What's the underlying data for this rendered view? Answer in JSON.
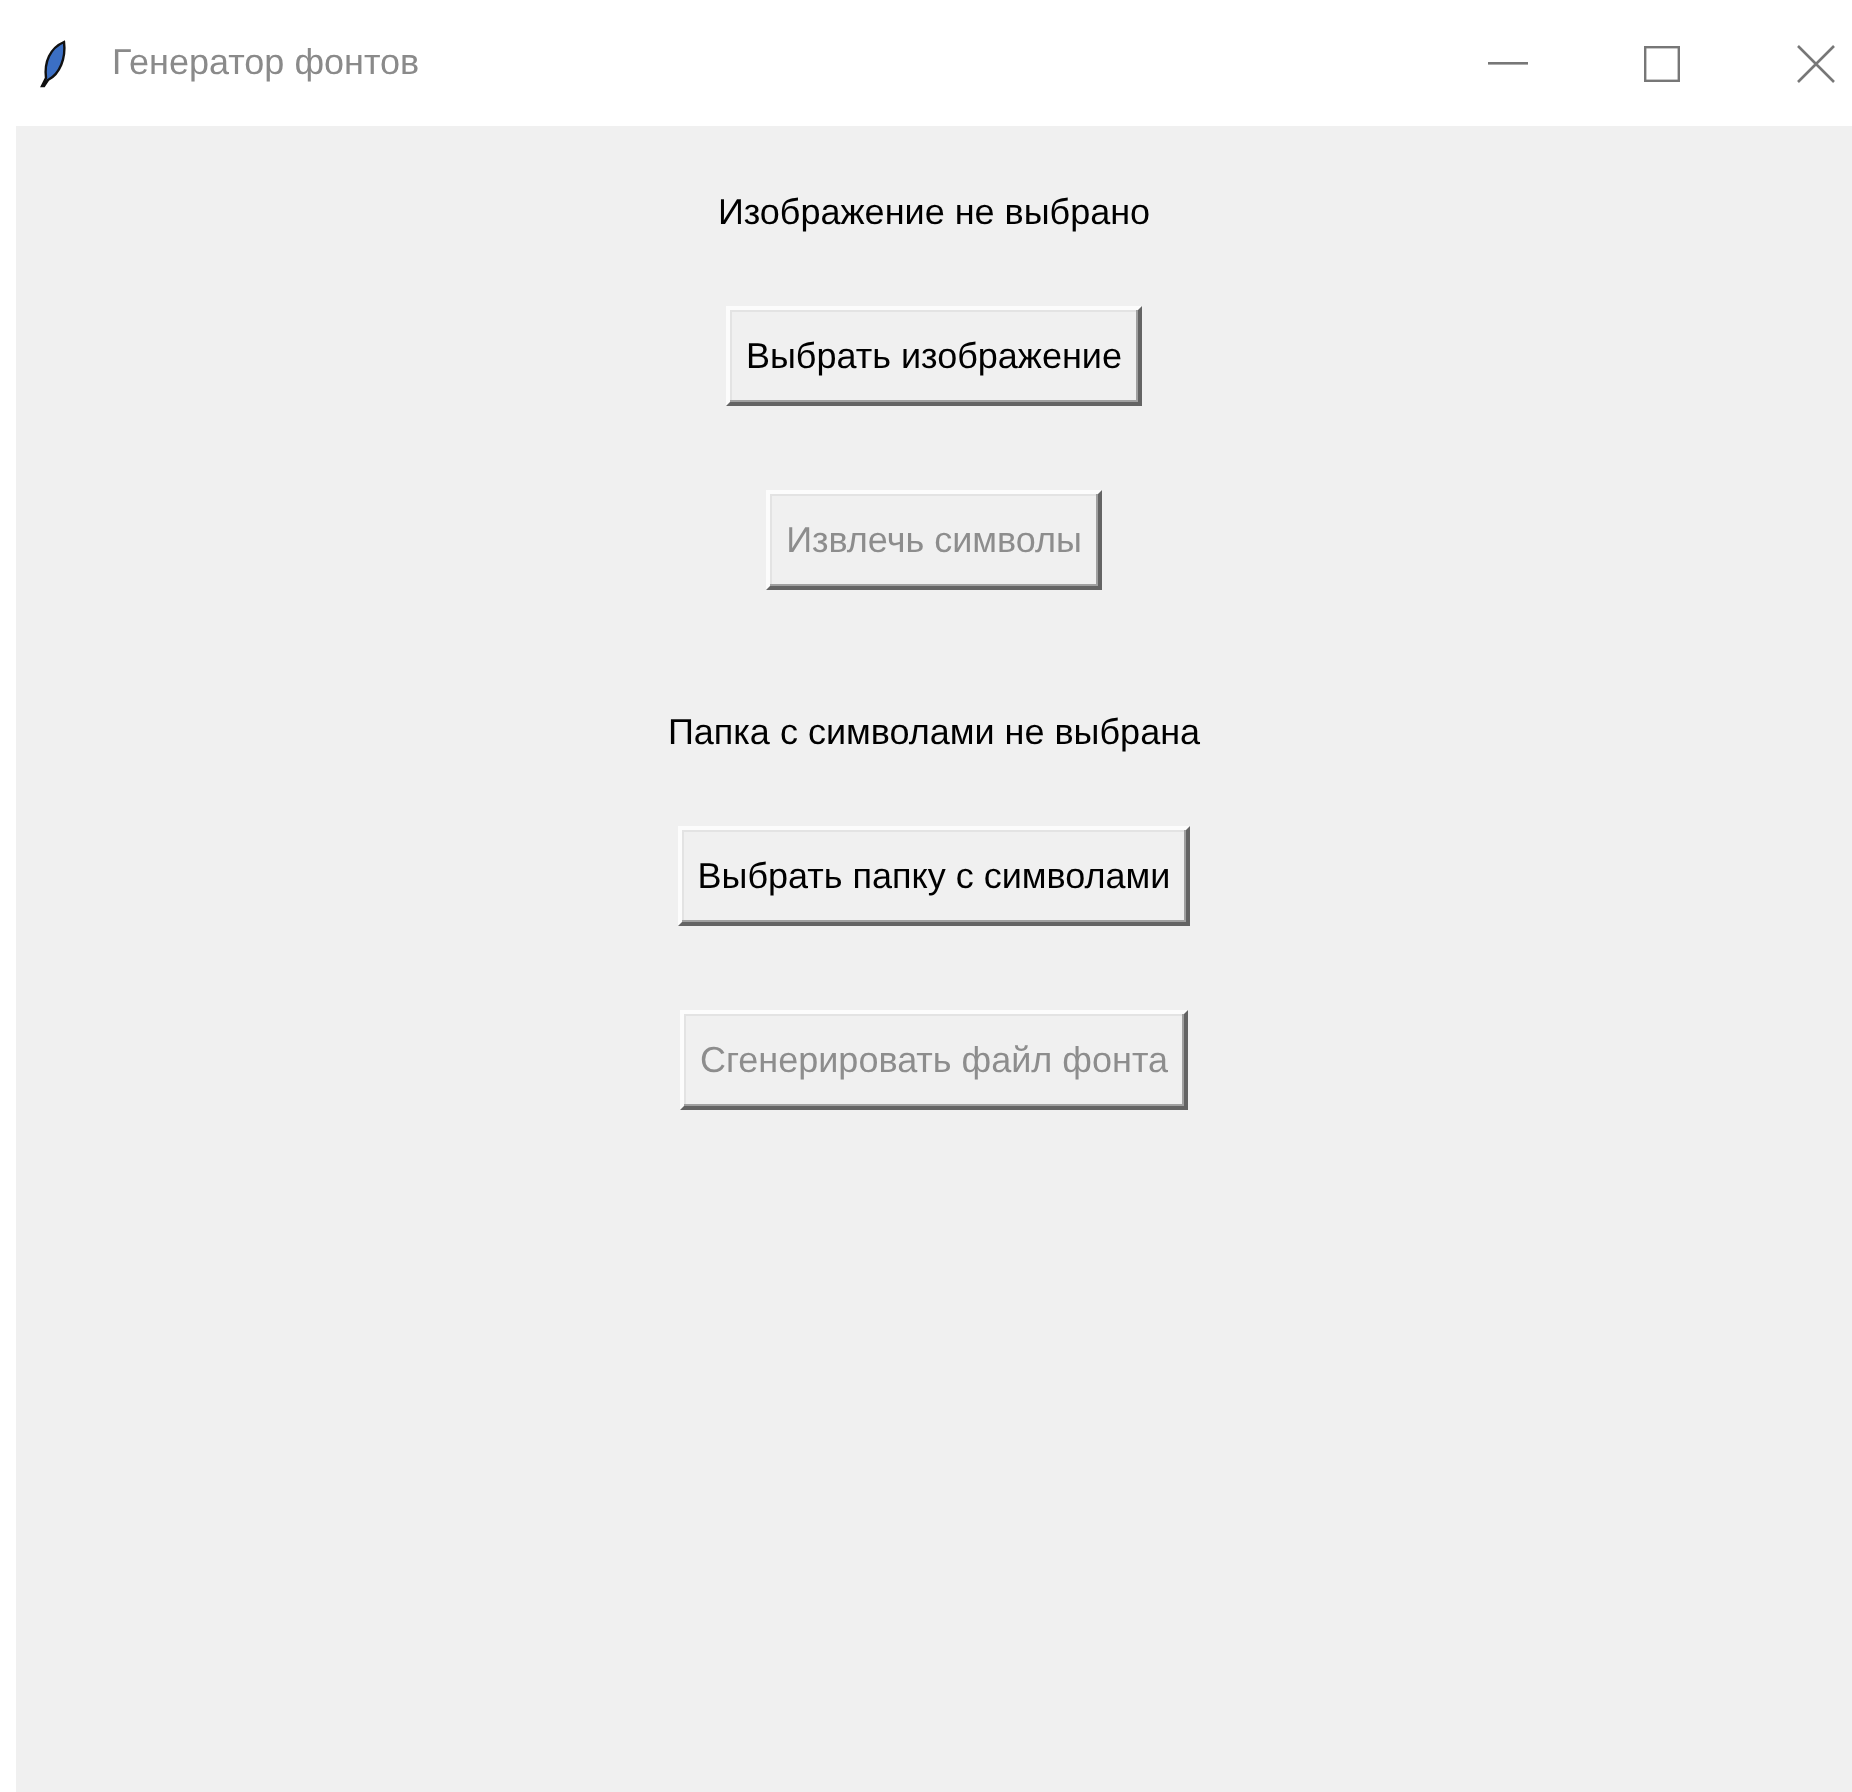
{
  "window": {
    "title": "Генератор фонтов"
  },
  "items": [
    {
      "kind": "label",
      "text": "Изображение не выбрано"
    },
    {
      "kind": "button",
      "text": "Выбрать изображение",
      "disabled": false
    },
    {
      "kind": "button",
      "text": "Извлечь символы",
      "disabled": true
    },
    {
      "kind": "label",
      "text": "Папка с символами не выбрана"
    },
    {
      "kind": "button",
      "text": "Выбрать папку с символами",
      "disabled": false
    },
    {
      "kind": "button",
      "text": "Сгенерировать файл фонта",
      "disabled": true
    }
  ]
}
